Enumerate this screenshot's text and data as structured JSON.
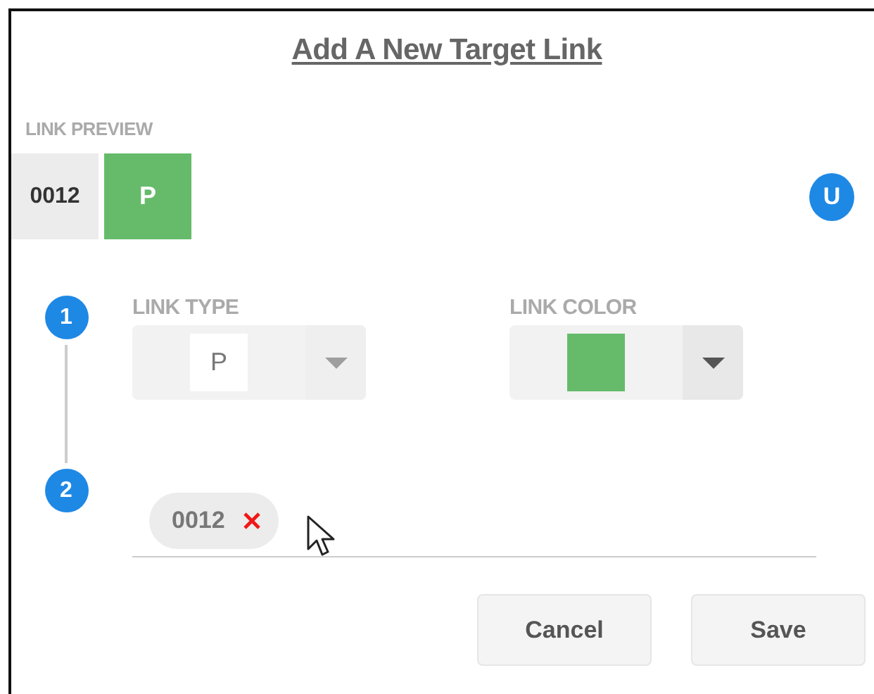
{
  "dialog": {
    "title": "Add A New Target Link"
  },
  "preview": {
    "label": "LINK PREVIEW",
    "code": "0012",
    "type": "P",
    "color": "#66bb6a",
    "badge": "U"
  },
  "steps": [
    "1",
    "2"
  ],
  "link_type": {
    "label": "LINK TYPE",
    "value": "P",
    "disabled": true
  },
  "link_color": {
    "label": "LINK COLOR",
    "color": "#66bb6a",
    "disabled": false
  },
  "chips": [
    {
      "text": "0012"
    }
  ],
  "buttons": [
    "Cancel",
    "Save"
  ]
}
